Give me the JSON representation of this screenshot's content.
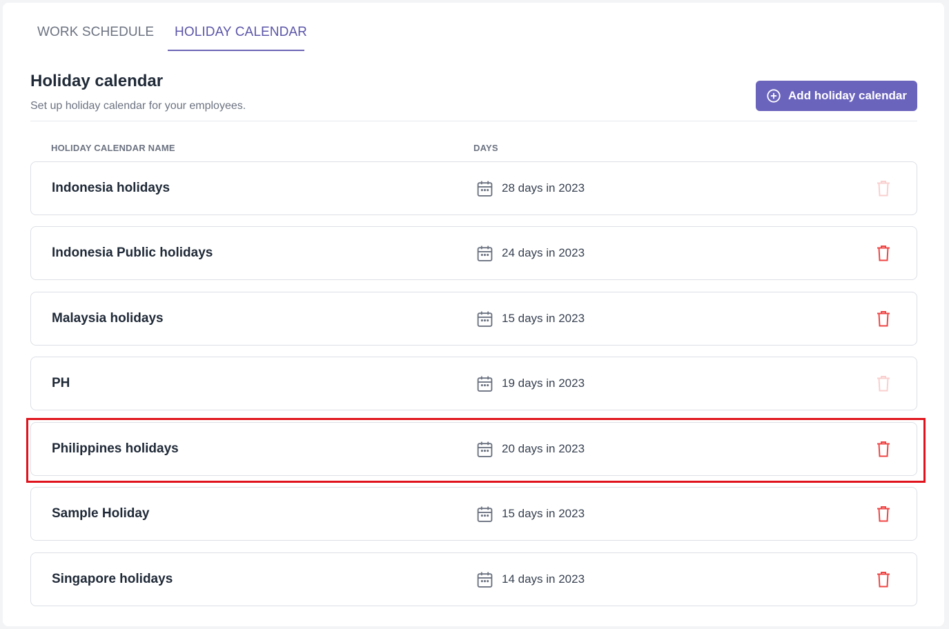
{
  "tabs": [
    {
      "label": "WORK SCHEDULE",
      "active": false
    },
    {
      "label": "HOLIDAY CALENDAR",
      "active": true
    }
  ],
  "header": {
    "title": "Holiday calendar",
    "subtitle": "Set up holiday calendar for your employees.",
    "add_button_label": "Add holiday calendar",
    "add_button_icon": "plus-circle-icon"
  },
  "columns": {
    "name": "HOLIDAY CALENDAR NAME",
    "days": "DAYS"
  },
  "rows": [
    {
      "name": "Indonesia holidays",
      "days": "28 days in 2023",
      "delete_enabled": false
    },
    {
      "name": "Indonesia Public holidays",
      "days": "24 days in 2023",
      "delete_enabled": true
    },
    {
      "name": "Malaysia holidays",
      "days": "15 days in 2023",
      "delete_enabled": true
    },
    {
      "name": "PH",
      "days": "19 days in 2023",
      "delete_enabled": false
    },
    {
      "name": "Philippines holidays",
      "days": "20 days in 2023",
      "delete_enabled": true,
      "highlighted": true
    },
    {
      "name": "Sample Holiday",
      "days": "15 days in 2023",
      "delete_enabled": true
    },
    {
      "name": "Singapore holidays",
      "days": "14 days in 2023",
      "delete_enabled": true
    }
  ],
  "colors": {
    "accent": "#6b64bd",
    "danger": "#ef4444",
    "highlight_border": "#e0121b"
  }
}
